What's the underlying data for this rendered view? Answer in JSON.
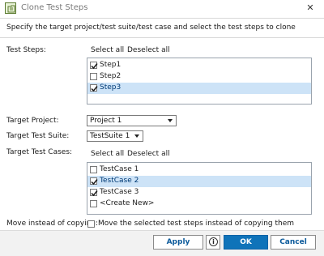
{
  "window": {
    "title": "Clone Test Steps"
  },
  "instruction": "Specify the target project/test suite/test case and select the test steps to clone",
  "test_steps": {
    "label": "Test Steps:",
    "select_all": "Select all",
    "deselect_all": "Deselect all",
    "items": [
      {
        "label": "Step1",
        "checked": true,
        "selected": false
      },
      {
        "label": "Step2",
        "checked": false,
        "selected": false
      },
      {
        "label": "Step3",
        "checked": true,
        "selected": true
      }
    ]
  },
  "target_project": {
    "label": "Target Project:",
    "value": "Project 1"
  },
  "target_suite": {
    "label": "Target Test Suite:",
    "value": "TestSuite 1"
  },
  "test_cases": {
    "label": "Target Test Cases:",
    "select_all": "Select all",
    "deselect_all": "Deselect all",
    "items": [
      {
        "label": "TestCase 1",
        "checked": false,
        "selected": false
      },
      {
        "label": "TestCase 2",
        "checked": true,
        "selected": true
      },
      {
        "label": "TestCase 3",
        "checked": true,
        "selected": false
      },
      {
        "label": "<Create New>",
        "checked": false,
        "selected": false
      }
    ]
  },
  "move": {
    "label": "Move instead of copying:",
    "text": "Move the selected test steps instead of copying them",
    "checked": false
  },
  "buttons": {
    "apply": "Apply",
    "info": "i",
    "ok": "OK",
    "cancel": "Cancel"
  },
  "colors": {
    "accent": "#0f73b9",
    "selection": "#cde3f7",
    "link_text": "#0b5a9b"
  }
}
